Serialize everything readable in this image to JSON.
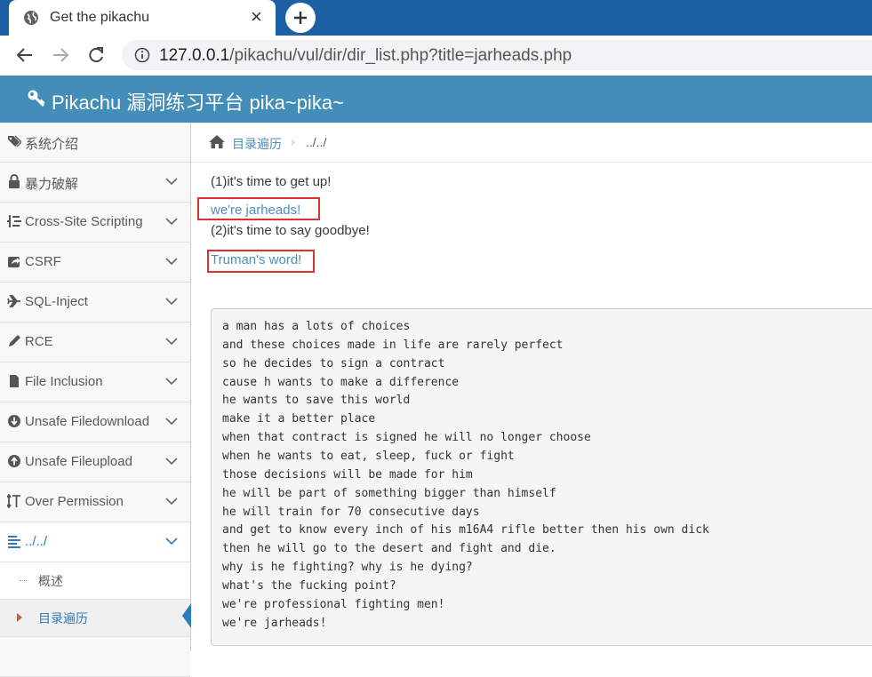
{
  "browser": {
    "tab_title": "Get the pikachu",
    "tab_close": "×",
    "url_host": "127.0.0.1",
    "url_path": "/pikachu/vul/dir/dir_list.php?title=jarheads.php"
  },
  "header": {
    "title": "Pikachu 漏洞练习平台 pika~pika~"
  },
  "sidebar": {
    "items": [
      {
        "label": "系统介绍",
        "icon": "tags-icon"
      },
      {
        "label": "暴力破解",
        "icon": "lock-icon"
      },
      {
        "label": "Cross-Site Scripting",
        "icon": "list-icon"
      },
      {
        "label": "CSRF",
        "icon": "share-icon"
      },
      {
        "label": "SQL-Inject",
        "icon": "plane-icon"
      },
      {
        "label": "RCE",
        "icon": "pencil-icon"
      },
      {
        "label": "File Inclusion",
        "icon": "file-icon"
      },
      {
        "label": "Unsafe Filedownload",
        "icon": "download-icon"
      },
      {
        "label": "Unsafe Fileupload",
        "icon": "upload-icon"
      },
      {
        "label": "Over Permission",
        "icon": "text-height-icon"
      },
      {
        "label": "../../",
        "icon": "align-icon"
      }
    ],
    "sub_items": [
      {
        "label": "概述"
      },
      {
        "label": "目录遍历"
      }
    ]
  },
  "breadcrumb": {
    "link": "目录遍历",
    "separator": "›",
    "current": "../../"
  },
  "content": {
    "line1": "(1)it's time to get up!",
    "link1": "we're jarheads!",
    "line2": "(2)it's time to say goodbye!",
    "link2": "Truman's word!",
    "poem": [
      "a man has a lots of choices",
      "and these choices made in life are rarely perfect",
      "so he decides to sign a contract",
      "cause h wants to make a difference",
      "he wants to save this world",
      "make it a better place",
      "when that contract is signed he will no longer choose",
      "when he wants to eat, sleep, fuck or fight",
      "those decisions will be made for him",
      "he will be part of something bigger than himself",
      "he will train for 70 consecutive days",
      "and get to know every inch of his m16A4 rifle better then his own dick",
      "then he will go to the desert and fight and die.",
      "why is he fighting? why is he dying?",
      "what's the fucking point?",
      "we're professional fighting men!",
      "we're jarheads!"
    ]
  },
  "colors": {
    "header_bg": "#438eb9",
    "tab_strip": "#1d5fa3",
    "link": "#4c8fbd",
    "highlight_box": "#e03131"
  }
}
